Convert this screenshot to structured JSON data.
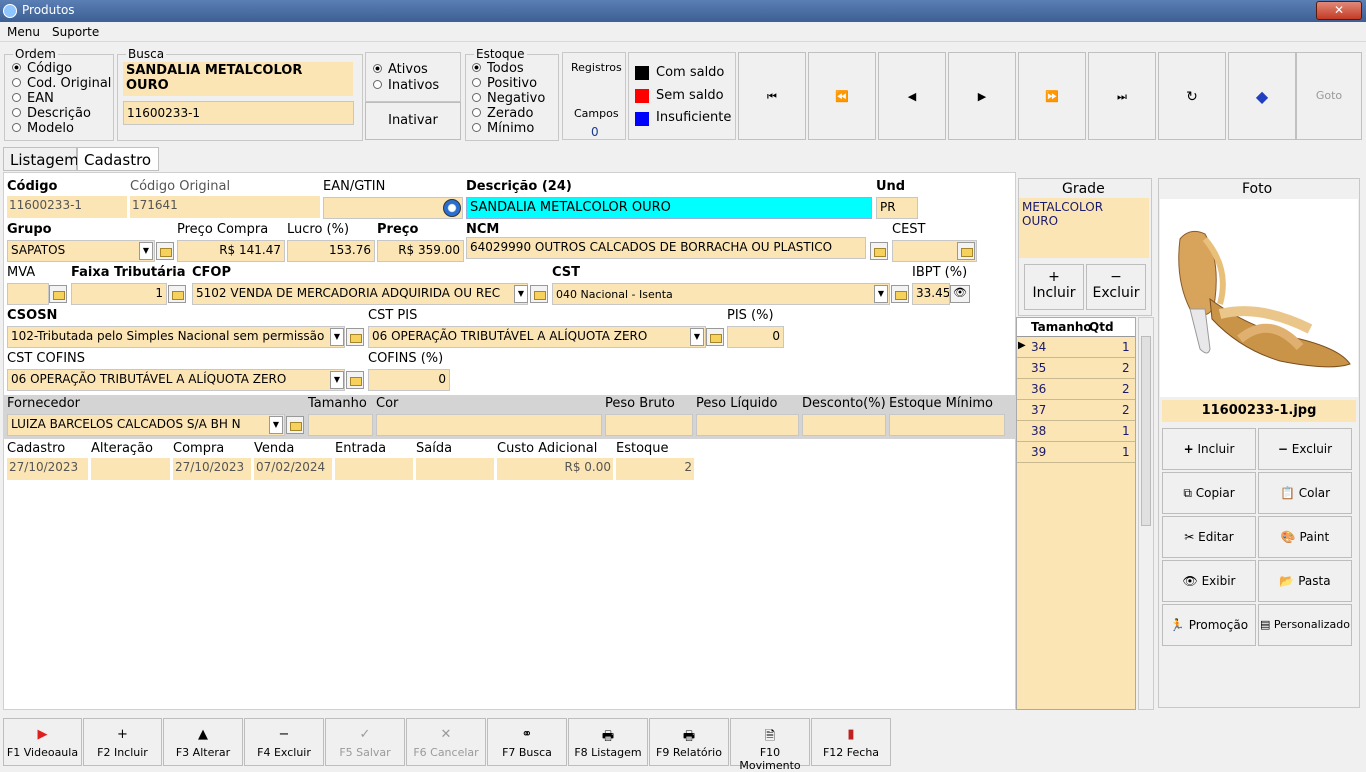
{
  "window": {
    "title": "Produtos"
  },
  "menu": {
    "items": [
      "Menu",
      "Suporte"
    ]
  },
  "ordem": {
    "legend": "Ordem",
    "options": [
      "Código",
      "Cod. Original",
      "EAN",
      "Descrição",
      "Modelo"
    ]
  },
  "busca": {
    "legend": "Busca",
    "result": "SANDALIA METALCOLOR OURO",
    "line1": "SANDALIA METALCOLOR",
    "line2": "OURO",
    "input": "11600233-1"
  },
  "ativos": {
    "options": [
      "Ativos",
      "Inativos"
    ],
    "button": "Inativar"
  },
  "estoque": {
    "legend": "Estoque",
    "options": [
      "Todos",
      "Positivo",
      "Negativo",
      "Zerado",
      "Mínimo"
    ]
  },
  "registros": {
    "label": "Registros",
    "campos_label": "Campos",
    "campos_value": "0"
  },
  "legendas": [
    {
      "label": "Com saldo",
      "color": "#000000"
    },
    {
      "label": "Sem saldo",
      "color": "#ff0000"
    },
    {
      "label": "Insuficiente",
      "color": "#0000ff"
    }
  ],
  "nav": {
    "goto": "Goto"
  },
  "tabs": [
    "Listagem",
    "Cadastro"
  ],
  "form": {
    "codigo_label": "Código",
    "codigo": "11600233-1",
    "cod_original_label": "Código Original",
    "cod_original": "171641",
    "ean_label": "EAN/GTIN",
    "ean": "",
    "descricao_label": "Descrição (24)",
    "descricao": "SANDALIA METALCOLOR OURO",
    "und_label": "Und",
    "und": "PR",
    "grupo_label": "Grupo",
    "grupo": "SAPATOS",
    "preco_compra_label": "Preço Compra",
    "preco_compra": "R$ 141.47",
    "lucro_label": "Lucro (%)",
    "lucro": "153.76",
    "preco_label": "Preço",
    "preco": "R$ 359.00",
    "ncm_label": "NCM",
    "ncm": "64029990 OUTROS CALCADOS DE BORRACHA OU PLASTICO",
    "cest_label": "CEST",
    "cest": "",
    "mva_label": "MVA",
    "mva": "",
    "faixa_label": "Faixa Tributária",
    "faixa": "1",
    "cfop_label": "CFOP",
    "cfop": "5102 VENDA DE MERCADORIA ADQUIRIDA OU REC",
    "cst_label": "CST",
    "cst": "040 Nacional - Isenta",
    "ibpt_label": "IBPT (%)",
    "ibpt": "33.45",
    "csosn_label": "CSOSN",
    "csosn": "102-Tributada pelo Simples Nacional sem permissão",
    "cst_pis_label": "CST PIS",
    "cst_pis": "06 OPERAÇÃO TRIBUTÁVEL A ALÍQUOTA ZERO",
    "pis_label": "PIS (%)",
    "pis": "0",
    "cst_cofins_label": "CST COFINS",
    "cst_cofins": "06 OPERAÇÃO TRIBUTÁVEL A ALÍQUOTA ZERO",
    "cofins_label": "COFINS (%)",
    "cofins": "0",
    "fornecedor_label": "Fornecedor",
    "fornecedor": "LUIZA BARCELOS CALCADOS S/A  BH N",
    "tamanho_label": "Tamanho",
    "cor_label": "Cor",
    "peso_bruto_label": "Peso Bruto",
    "peso_liquido_label": "Peso Líquido",
    "desconto_label": "Desconto(%)",
    "estoque_minimo_label": "Estoque Mínimo",
    "cadastro_label": "Cadastro",
    "cadastro": "27/10/2023",
    "alteracao_label": "Alteração",
    "alteracao": "",
    "compra_label": "Compra",
    "compra": "27/10/2023",
    "venda_label": "Venda",
    "venda": "07/02/2024",
    "entrada_label": "Entrada",
    "saida_label": "Saída",
    "custo_label": "Custo Adicional",
    "custo": "R$ 0.00",
    "estoque_label": "Estoque",
    "estoque": "2"
  },
  "grade": {
    "title": "Grade",
    "line1": "METALCOLOR",
    "line2": "OURO",
    "incluir": "Incluir",
    "excluir": "Excluir",
    "headers": [
      "Tamanho",
      "Qtd"
    ],
    "rows": [
      {
        "t": "34",
        "q": "1"
      },
      {
        "t": "35",
        "q": "2"
      },
      {
        "t": "36",
        "q": "2"
      },
      {
        "t": "37",
        "q": "2"
      },
      {
        "t": "38",
        "q": "1"
      },
      {
        "t": "39",
        "q": "1"
      }
    ]
  },
  "foto": {
    "title": "Foto",
    "filename": "11600233-1.jpg",
    "buttons": [
      "Incluir",
      "Excluir",
      "Copiar",
      "Colar",
      "Editar",
      "Paint",
      "Exibir",
      "Pasta",
      "Promoção",
      "Personalizado"
    ]
  },
  "fkeys": [
    "F1 Videoaula",
    "F2 Incluir",
    "F3 Alterar",
    "F4 Excluir",
    "F5 Salvar",
    "F6 Cancelar",
    "F7 Busca",
    "F8 Listagem",
    "F9 Relatório",
    "F10 Movimento",
    "F12 Fecha"
  ]
}
